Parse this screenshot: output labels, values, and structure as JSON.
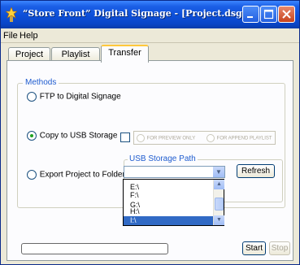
{
  "window": {
    "title": "“Store Front” Digital Signage - [Project.dsg]"
  },
  "menu": [
    "File",
    "Help"
  ],
  "tabs": [
    {
      "label": "Project"
    },
    {
      "label": "Playlist"
    },
    {
      "label": "Transfer"
    }
  ],
  "transfer": {
    "methods_legend": "Methods",
    "ftp_label": "FTP to Digital Signage",
    "usb_label": "Copy to USB Storage",
    "preview_only_label": "FOR PREVIEW ONLY",
    "append_playlist_label": "FOR APPEND PLAYLIST",
    "export_label": "Export Project to Folder",
    "usb_path_legend": "USB Storage Path",
    "usb_path_value": "",
    "refresh_label": "Refresh",
    "drive_options": [
      "E:\\",
      "F:\\",
      "G:\\",
      "H:\\",
      "I:\\"
    ],
    "selected_drive": "I:\\",
    "start_label": "Start",
    "stop_label": "Stop",
    "progress": 0
  },
  "icons": {
    "app": "signage-icon",
    "minimize": "minimize-icon",
    "maximize": "maximize-icon",
    "close": "close-icon",
    "combo_arrow": "chevron-down-icon"
  }
}
